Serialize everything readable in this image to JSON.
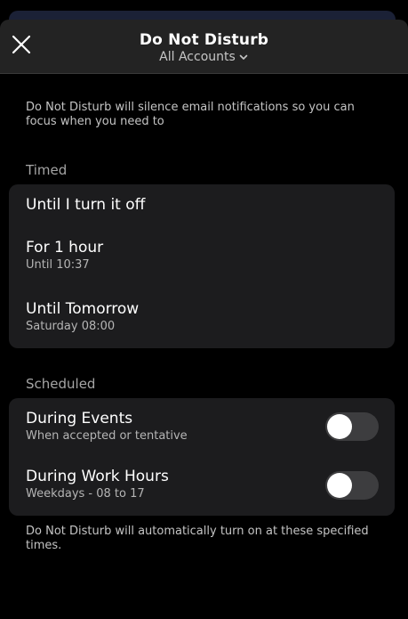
{
  "header": {
    "title": "Do Not Disturb",
    "account_selector": "All Accounts"
  },
  "intro_text": "Do Not Disturb will silence email notifications so you can focus when you need to",
  "timed": {
    "label": "Timed",
    "options": [
      {
        "title": "Until I turn it off",
        "subtitle": ""
      },
      {
        "title": "For 1 hour",
        "subtitle": "Until 10:37"
      },
      {
        "title": "Until Tomorrow",
        "subtitle": "Saturday 08:00"
      }
    ]
  },
  "scheduled": {
    "label": "Scheduled",
    "options": [
      {
        "title": "During Events",
        "subtitle": "When accepted or tentative",
        "enabled": false
      },
      {
        "title": "During Work Hours",
        "subtitle": "Weekdays - 08 to 17",
        "enabled": false
      }
    ]
  },
  "footer_note": "Do Not Disturb will automatically turn on at these specified times.",
  "colors": {
    "background": "#000000",
    "header": "#232323",
    "card": "#1c1c1e",
    "toggle_off": "#3d3d3f"
  },
  "icons": {
    "close": "close-icon",
    "account_chevron": "chevron-down-icon"
  }
}
